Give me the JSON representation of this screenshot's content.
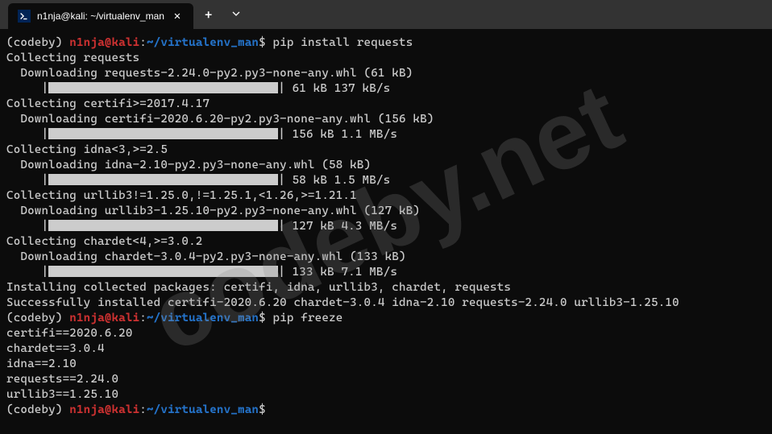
{
  "tab": {
    "title": "n1nja@kali: ~/virtualenv_man",
    "icon_label": "PS"
  },
  "prompt": {
    "venv": "(codeby)",
    "user": "n1nja@kali",
    "sep": ":",
    "path": "~/virtualenv_man",
    "dollar": "$"
  },
  "cmds": {
    "c1": "pip install requests",
    "c2": "pip freeze",
    "c3": ""
  },
  "output": {
    "l1": "Collecting requests",
    "l2": "  Downloading requests-2.24.0-py2.py3-none-any.whl (61 kB)",
    "l3a": "     |",
    "l3b": "| 61 kB 137 kB/s",
    "l4": "Collecting certifi>=2017.4.17",
    "l5": "  Downloading certifi-2020.6.20-py2.py3-none-any.whl (156 kB)",
    "l6a": "     |",
    "l6b": "| 156 kB 1.1 MB/s",
    "l7": "Collecting idna<3,>=2.5",
    "l8": "  Downloading idna-2.10-py2.py3-none-any.whl (58 kB)",
    "l9a": "     |",
    "l9b": "| 58 kB 1.5 MB/s",
    "l10": "Collecting urllib3!=1.25.0,!=1.25.1,<1.26,>=1.21.1",
    "l11": "  Downloading urllib3-1.25.10-py2.py3-none-any.whl (127 kB)",
    "l12a": "     |",
    "l12b": "| 127 kB 4.3 MB/s",
    "l13": "Collecting chardet<4,>=3.0.2",
    "l14": "  Downloading chardet-3.0.4-py2.py3-none-any.whl (133 kB)",
    "l15a": "     |",
    "l15b": "| 133 kB 7.1 MB/s",
    "l16": "Installing collected packages: certifi, idna, urllib3, chardet, requests",
    "l17": "Successfully installed certifi-2020.6.20 chardet-3.0.4 idna-2.10 requests-2.24.0 urllib3-1.25.10",
    "f1": "certifi==2020.6.20",
    "f2": "chardet==3.0.4",
    "f3": "idna==2.10",
    "f4": "requests==2.24.0",
    "f5": "urllib3==1.25.10"
  },
  "watermark": "codeby.net"
}
